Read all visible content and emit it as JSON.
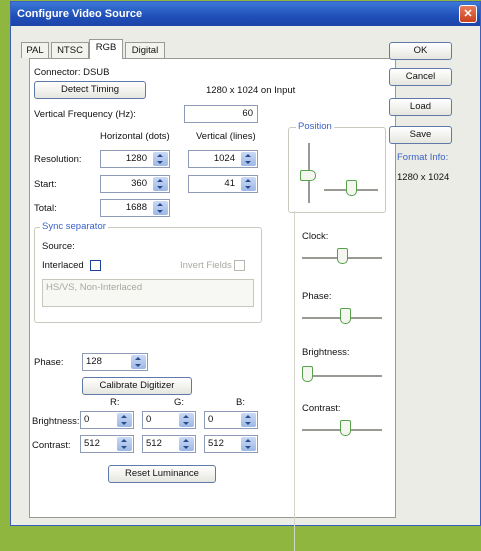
{
  "window": {
    "title": "Configure Video Source",
    "close_label": "✕"
  },
  "tabs": [
    {
      "label": "PAL"
    },
    {
      "label": "NTSC"
    },
    {
      "label": "RGB"
    },
    {
      "label": "Digital"
    }
  ],
  "rgb": {
    "connector_label": "Connector: DSUB",
    "detect_timing_label": "Detect Timing",
    "detected_mode": "1280 x 1024 on Input",
    "vfreq_label": "Vertical Frequency (Hz):",
    "vfreq_value": "60",
    "col_horizontal": "Horizontal (dots)",
    "col_vertical": "Vertical (lines)",
    "resolution_label": "Resolution:",
    "resolution_h": "1280",
    "resolution_v": "1024",
    "start_label": "Start:",
    "start_h": "360",
    "start_v": "41",
    "total_label": "Total:",
    "total_h": "1688",
    "sync": {
      "legend": "Sync separator",
      "source_label": "Source:",
      "interlaced_label": "Interlaced",
      "invert_fields_label": "Invert Fields",
      "mode_text": "HS/VS, Non-Interlaced"
    },
    "phase_label": "Phase:",
    "phase_value": "128",
    "calibrate_label": "Calibrate Digitizer",
    "col_r": "R:",
    "col_g": "G:",
    "col_b": "B:",
    "brightness_label": "Brightness:",
    "brightness": {
      "r": "0",
      "g": "0",
      "b": "0"
    },
    "contrast_label": "Contrast:",
    "contrast": {
      "r": "512",
      "g": "512",
      "b": "512"
    },
    "reset_luminance_label": "Reset Luminance",
    "position_legend": "Position",
    "clock_label": "Clock:",
    "phase_slider_label": "Phase:",
    "brightness_slider_label": "Brightness:",
    "contrast_slider_label": "Contrast:",
    "slider_levels": {
      "clock": 0.5,
      "phase": 0.55,
      "brightness": 0.0,
      "contrast": 0.55,
      "position_h": 0.5,
      "position_v": 0.55
    }
  },
  "side_buttons": {
    "ok": "OK",
    "cancel": "Cancel",
    "load": "Load",
    "save": "Save",
    "format_info_label": "Format Info:",
    "format_info_value": "1280 x 1024"
  }
}
